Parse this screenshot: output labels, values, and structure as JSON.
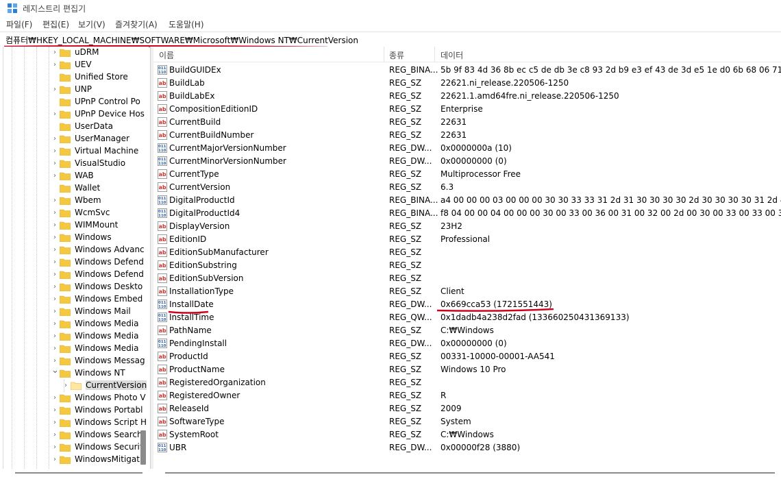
{
  "window": {
    "title": "레지스트리 편집기"
  },
  "menu": [
    {
      "label": "파일(F)"
    },
    {
      "label": "편집(E)"
    },
    {
      "label": "보기(V)"
    },
    {
      "label": "즐겨찾기(A)"
    },
    {
      "label": "도움말(H)"
    }
  ],
  "address": {
    "path": "컴퓨터₩HKEY_LOCAL_MACHINE₩SOFTWARE₩Microsoft₩Windows NT₩CurrentVersion"
  },
  "tree": {
    "items": [
      {
        "label": "uDRM",
        "expandable": true
      },
      {
        "label": "UEV",
        "expandable": true
      },
      {
        "label": "Unified Store",
        "expandable": false
      },
      {
        "label": "UNP",
        "expandable": true
      },
      {
        "label": "UPnP Control Po",
        "expandable": false
      },
      {
        "label": "UPnP Device Hos",
        "expandable": true
      },
      {
        "label": "UserData",
        "expandable": false
      },
      {
        "label": "UserManager",
        "expandable": true
      },
      {
        "label": "Virtual Machine",
        "expandable": true
      },
      {
        "label": "VisualStudio",
        "expandable": true
      },
      {
        "label": "WAB",
        "expandable": true
      },
      {
        "label": "Wallet",
        "expandable": false
      },
      {
        "label": "Wbem",
        "expandable": true
      },
      {
        "label": "WcmSvc",
        "expandable": true
      },
      {
        "label": "WIMMount",
        "expandable": true
      },
      {
        "label": "Windows",
        "expandable": true
      },
      {
        "label": "Windows Advanc",
        "expandable": true
      },
      {
        "label": "Windows Defend",
        "expandable": true
      },
      {
        "label": "Windows Defend",
        "expandable": true
      },
      {
        "label": "Windows Deskto",
        "expandable": true
      },
      {
        "label": "Windows Embed",
        "expandable": true
      },
      {
        "label": "Windows Mail",
        "expandable": true
      },
      {
        "label": "Windows Media",
        "expandable": true
      },
      {
        "label": "Windows Media",
        "expandable": true
      },
      {
        "label": "Windows Media",
        "expandable": true
      },
      {
        "label": "Windows Messag",
        "expandable": true
      },
      {
        "label": "Windows NT",
        "expandable": true,
        "expanded": true
      },
      {
        "label": "CurrentVersion",
        "expandable": true,
        "child": true,
        "selected": true
      },
      {
        "label": "Windows Photo V",
        "expandable": true
      },
      {
        "label": "Windows Portabl",
        "expandable": true
      },
      {
        "label": "Windows Script H",
        "expandable": true
      },
      {
        "label": "Windows Search",
        "expandable": true
      },
      {
        "label": "Windows Securit",
        "expandable": true
      },
      {
        "label": "WindowsMitigati",
        "expandable": true
      }
    ]
  },
  "list": {
    "columns": {
      "name": "이름",
      "type": "종류",
      "data": "데이터"
    },
    "rows": [
      {
        "icon": "binary",
        "name": "BuildGUIDEx",
        "type": "REG_BINA...",
        "data": "5b 9f 83 4d 36 8b ec c5 de db 3e c8 93 2d b9 e3 ef 43 de 3d e5 1e d0 6b 68 06 71 03 2e"
      },
      {
        "icon": "string",
        "name": "BuildLab",
        "type": "REG_SZ",
        "data": "22621.ni_release.220506-1250"
      },
      {
        "icon": "string",
        "name": "BuildLabEx",
        "type": "REG_SZ",
        "data": "22621.1.amd64fre.ni_release.220506-1250"
      },
      {
        "icon": "string",
        "name": "CompositionEditionID",
        "type": "REG_SZ",
        "data": "Enterprise"
      },
      {
        "icon": "string",
        "name": "CurrentBuild",
        "type": "REG_SZ",
        "data": "22631"
      },
      {
        "icon": "string",
        "name": "CurrentBuildNumber",
        "type": "REG_SZ",
        "data": "22631"
      },
      {
        "icon": "binary",
        "name": "CurrentMajorVersionNumber",
        "type": "REG_DW...",
        "data": "0x0000000a (10)"
      },
      {
        "icon": "binary",
        "name": "CurrentMinorVersionNumber",
        "type": "REG_DW...",
        "data": "0x00000000 (0)"
      },
      {
        "icon": "string",
        "name": "CurrentType",
        "type": "REG_SZ",
        "data": "Multiprocessor Free"
      },
      {
        "icon": "string",
        "name": "CurrentVersion",
        "type": "REG_SZ",
        "data": "6.3"
      },
      {
        "icon": "binary",
        "name": "DigitalProductId",
        "type": "REG_BINA...",
        "data": "a4 00 00 00 03 00 00 00 30 30 33 33 31 2d 31 30 30 30 30 2d 30 30 30 30 31 2d 41 41"
      },
      {
        "icon": "binary",
        "name": "DigitalProductId4",
        "type": "REG_BINA...",
        "data": "f8 04 00 00 04 00 00 00 30 00 33 00 36 00 31 00 32 00 2d 00 30 00 33 00 33 00 31 00"
      },
      {
        "icon": "string",
        "name": "DisplayVersion",
        "type": "REG_SZ",
        "data": "23H2"
      },
      {
        "icon": "string",
        "name": "EditionID",
        "type": "REG_SZ",
        "data": "Professional"
      },
      {
        "icon": "string",
        "name": "EditionSubManufacturer",
        "type": "REG_SZ",
        "data": ""
      },
      {
        "icon": "string",
        "name": "EditionSubstring",
        "type": "REG_SZ",
        "data": ""
      },
      {
        "icon": "string",
        "name": "EditionSubVersion",
        "type": "REG_SZ",
        "data": ""
      },
      {
        "icon": "string",
        "name": "InstallationType",
        "type": "REG_SZ",
        "data": "Client"
      },
      {
        "icon": "binary",
        "name": "InstallDate",
        "type": "REG_DW...",
        "data": "0x669cca53 (1721551443)",
        "highlight": true
      },
      {
        "icon": "binary",
        "name": "InstallTime",
        "type": "REG_QW...",
        "data": "0x1dadb4a238d2fad (133660250431369133)"
      },
      {
        "icon": "string",
        "name": "PathName",
        "type": "REG_SZ",
        "data": "C:₩Windows"
      },
      {
        "icon": "binary",
        "name": "PendingInstall",
        "type": "REG_DW...",
        "data": "0x00000000 (0)"
      },
      {
        "icon": "string",
        "name": "ProductId",
        "type": "REG_SZ",
        "data": "00331-10000-00001-AA541"
      },
      {
        "icon": "string",
        "name": "ProductName",
        "type": "REG_SZ",
        "data": "Windows 10 Pro"
      },
      {
        "icon": "string",
        "name": "RegisteredOrganization",
        "type": "REG_SZ",
        "data": ""
      },
      {
        "icon": "string",
        "name": "RegisteredOwner",
        "type": "REG_SZ",
        "data": "R"
      },
      {
        "icon": "string",
        "name": "ReleaseId",
        "type": "REG_SZ",
        "data": "2009"
      },
      {
        "icon": "string",
        "name": "SoftwareType",
        "type": "REG_SZ",
        "data": "System"
      },
      {
        "icon": "string",
        "name": "SystemRoot",
        "type": "REG_SZ",
        "data": "C:₩Windows"
      },
      {
        "icon": "binary",
        "name": "UBR",
        "type": "REG_DW...",
        "data": "0x00000f28 (3880)"
      }
    ]
  },
  "colors": {
    "annotation_red": "#d0021b",
    "folder": "#f5c842",
    "string_icon": "#c8352e",
    "binary_icon": "#2b5fa8"
  }
}
